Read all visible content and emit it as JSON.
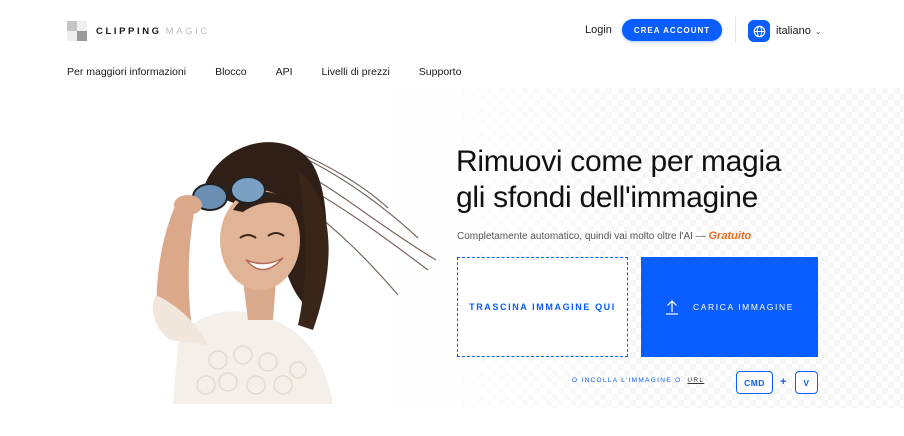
{
  "header": {
    "logo": {
      "word1": "CLIPPING",
      "word2": "MAGIC"
    },
    "login_label": "Login",
    "signup_label": "CREA ACCOUNT",
    "language_label": "italiano"
  },
  "nav": {
    "items": [
      {
        "label": "Per maggiori informazioni"
      },
      {
        "label": "Blocco"
      },
      {
        "label": "API"
      },
      {
        "label": "Livelli di prezzi"
      },
      {
        "label": "Supporto"
      }
    ]
  },
  "hero": {
    "headline_line1": "Rimuovi come per magia",
    "headline_line2": "gli sfondi dell'immagine",
    "subtitle": "Completamente automatico, quindi vai molto oltre l'AI —",
    "free_label": "Gratuito",
    "drop_label": "TRASCINA IMMAGINE QUI",
    "upload_label": "CARICA IMMAGINE",
    "paste_prefix": "O INCOLLA L'IMMAGINE O",
    "paste_url": "URL",
    "shortcut_key1": "CMD",
    "shortcut_plus": "+",
    "shortcut_key2": "V"
  },
  "colors": {
    "accent": "#0a5dff",
    "free_orange": "#f26b1d",
    "text": "#111111"
  },
  "icons": {
    "language": "globe-icon",
    "upload": "upload-arrow-icon",
    "language_caret": "chevron-down-icon"
  }
}
